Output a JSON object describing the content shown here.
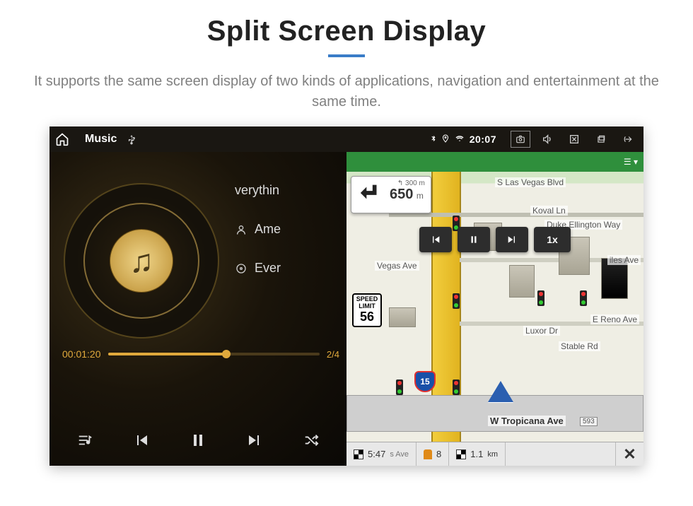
{
  "heading": {
    "title": "Split Screen Display"
  },
  "description": "It supports the same screen display of two kinds of applications, navigation and entertainment at the same time.",
  "status_bar": {
    "app_title": "Music",
    "clock": "20:07"
  },
  "music": {
    "track_title": "verythin",
    "artist": "Ame",
    "album": "Ever",
    "elapsed": "00:01:20",
    "track_index": "2/4"
  },
  "nav": {
    "top_menu": "☰ ▾",
    "turn_distance": "650",
    "turn_unit": "m",
    "turn_sub": "300 m",
    "playback_speed": "1x",
    "speed_limit_label": "SPEED LIMIT",
    "speed_limit_value": "56",
    "interstate": "15",
    "streets": {
      "top": "S Las Vegas Blvd",
      "koval": "Koval Ln",
      "duke": "Duke Ellington Way",
      "vegasave": "Vegas Ave",
      "luxor": "Luxor Dr",
      "stable": "Stable Rd",
      "reno": "E Reno Ave",
      "iles": "iles Ave",
      "tropicana": "W Tropicana Ave",
      "tropicana_num": "593",
      "bottom_left": "s Ave"
    },
    "bottom": {
      "eta": "5:47",
      "work": "8",
      "remaining": "1.1",
      "remaining_unit": "km"
    }
  }
}
